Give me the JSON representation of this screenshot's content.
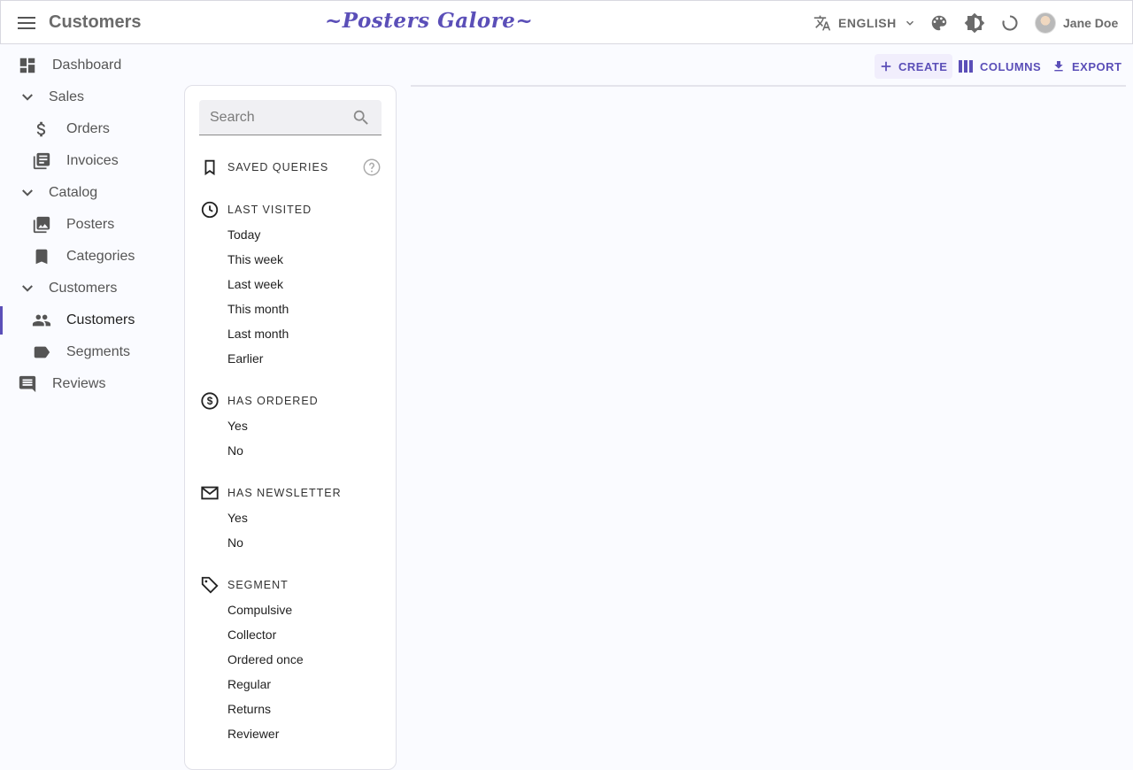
{
  "header": {
    "page_title": "Customers",
    "brand": "~Posters Galore~",
    "language": "ENGLISH",
    "user_name": "Jane Doe"
  },
  "sidebar": {
    "items": [
      {
        "label": "Dashboard",
        "icon": "dashboard-icon"
      },
      {
        "label": "Sales",
        "icon": "chevron-down-icon"
      },
      {
        "label": "Orders",
        "icon": "dollar-icon"
      },
      {
        "label": "Invoices",
        "icon": "library-books-icon"
      },
      {
        "label": "Catalog",
        "icon": "chevron-down-icon"
      },
      {
        "label": "Posters",
        "icon": "collections-icon"
      },
      {
        "label": "Categories",
        "icon": "bookmark-icon"
      },
      {
        "label": "Customers",
        "icon": "chevron-down-icon"
      },
      {
        "label": "Customers",
        "icon": "people-icon"
      },
      {
        "label": "Segments",
        "icon": "label-icon"
      },
      {
        "label": "Reviews",
        "icon": "comment-icon"
      }
    ]
  },
  "filters": {
    "search_placeholder": "Search",
    "saved_queries": "Saved queries",
    "last_visited": {
      "title": "Last visited",
      "items": [
        "Today",
        "This week",
        "Last week",
        "This month",
        "Last month",
        "Earlier"
      ]
    },
    "has_ordered": {
      "title": "Has ordered",
      "items": [
        "Yes",
        "No"
      ]
    },
    "has_newsletter": {
      "title": "Has newsletter",
      "items": [
        "Yes",
        "No"
      ]
    },
    "segment": {
      "title": "Segment",
      "items": [
        "Compulsive",
        "Collector",
        "Ordered once",
        "Regular",
        "Returns",
        "Reviewer"
      ]
    }
  },
  "toolbar": {
    "create": "CREATE",
    "columns": "COLUMNS",
    "export": "EXPORT"
  },
  "colors": {
    "accent": "#5b4fb8",
    "background": "#fafbff"
  }
}
